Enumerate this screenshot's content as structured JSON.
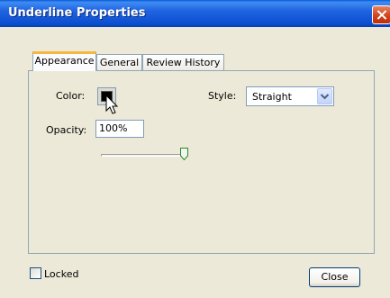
{
  "window": {
    "title": "Underline Properties"
  },
  "tabs": [
    {
      "label": "Appearance",
      "active": true
    },
    {
      "label": "General",
      "active": false
    },
    {
      "label": "Review History",
      "active": false
    }
  ],
  "appearance": {
    "color_label": "Color:",
    "color_value": "#000000",
    "style_label": "Style:",
    "style_value": "Straight",
    "opacity_label": "Opacity:",
    "opacity_value": "100%",
    "opacity_slider_fraction": 1.0
  },
  "footer": {
    "locked_label": "Locked",
    "locked_checked": false,
    "close_label": "Close"
  },
  "colors": {
    "title_bar": "#2164e0",
    "dialog_bg": "#ece9d8",
    "close_button": "#d2431b",
    "active_tab_accent": "#f6b83f"
  }
}
